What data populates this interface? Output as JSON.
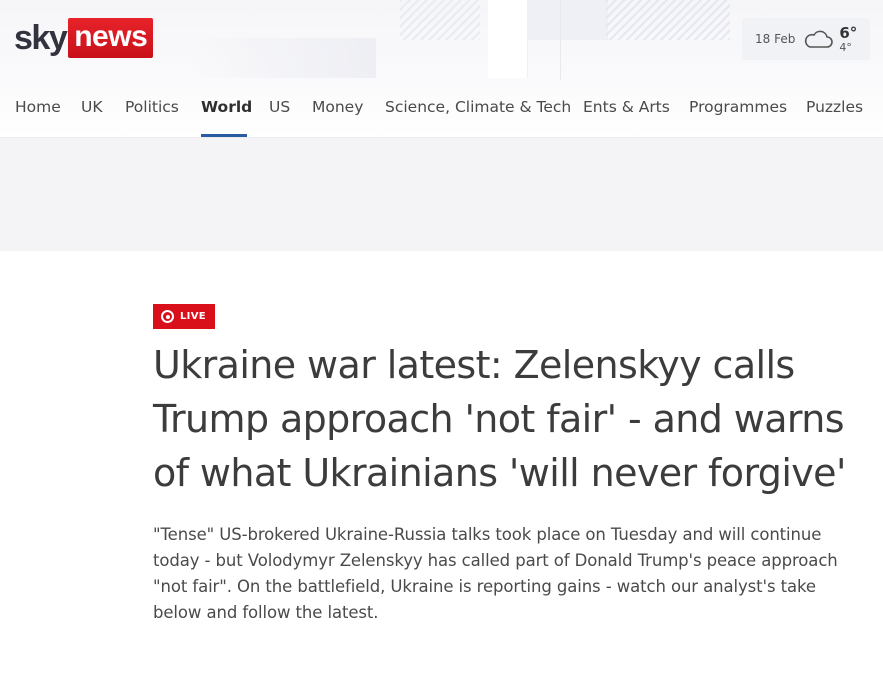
{
  "brand": {
    "sky": "sky",
    "news": "news",
    "accent": "#d9101a"
  },
  "weather": {
    "date": "18 Feb",
    "icon": "cloud-icon",
    "high": "6°",
    "low": "4°"
  },
  "nav": {
    "items": [
      {
        "label": "Home"
      },
      {
        "label": "UK"
      },
      {
        "label": "Politics"
      },
      {
        "label": "World",
        "active": true
      },
      {
        "label": "US"
      },
      {
        "label": "Money"
      },
      {
        "label": "Science, Climate & Tech"
      },
      {
        "label": "Ents & Arts"
      },
      {
        "label": "Programmes"
      },
      {
        "label": "Puzzles"
      }
    ]
  },
  "article": {
    "live_label": "LIVE",
    "headline": "Ukraine war latest: Zelenskyy calls Trump approach 'not fair' - and warns of what Ukrainians 'will never forgive'",
    "standfirst": "\"Tense\" US-brokered Ukraine-Russia talks took place on Tuesday and will continue today - but Volodymyr Zelenskyy has called part of Donald Trump's peace approach \"not fair\". On the battlefield, Ukraine is reporting gains - watch our analyst's take below and follow the latest."
  }
}
